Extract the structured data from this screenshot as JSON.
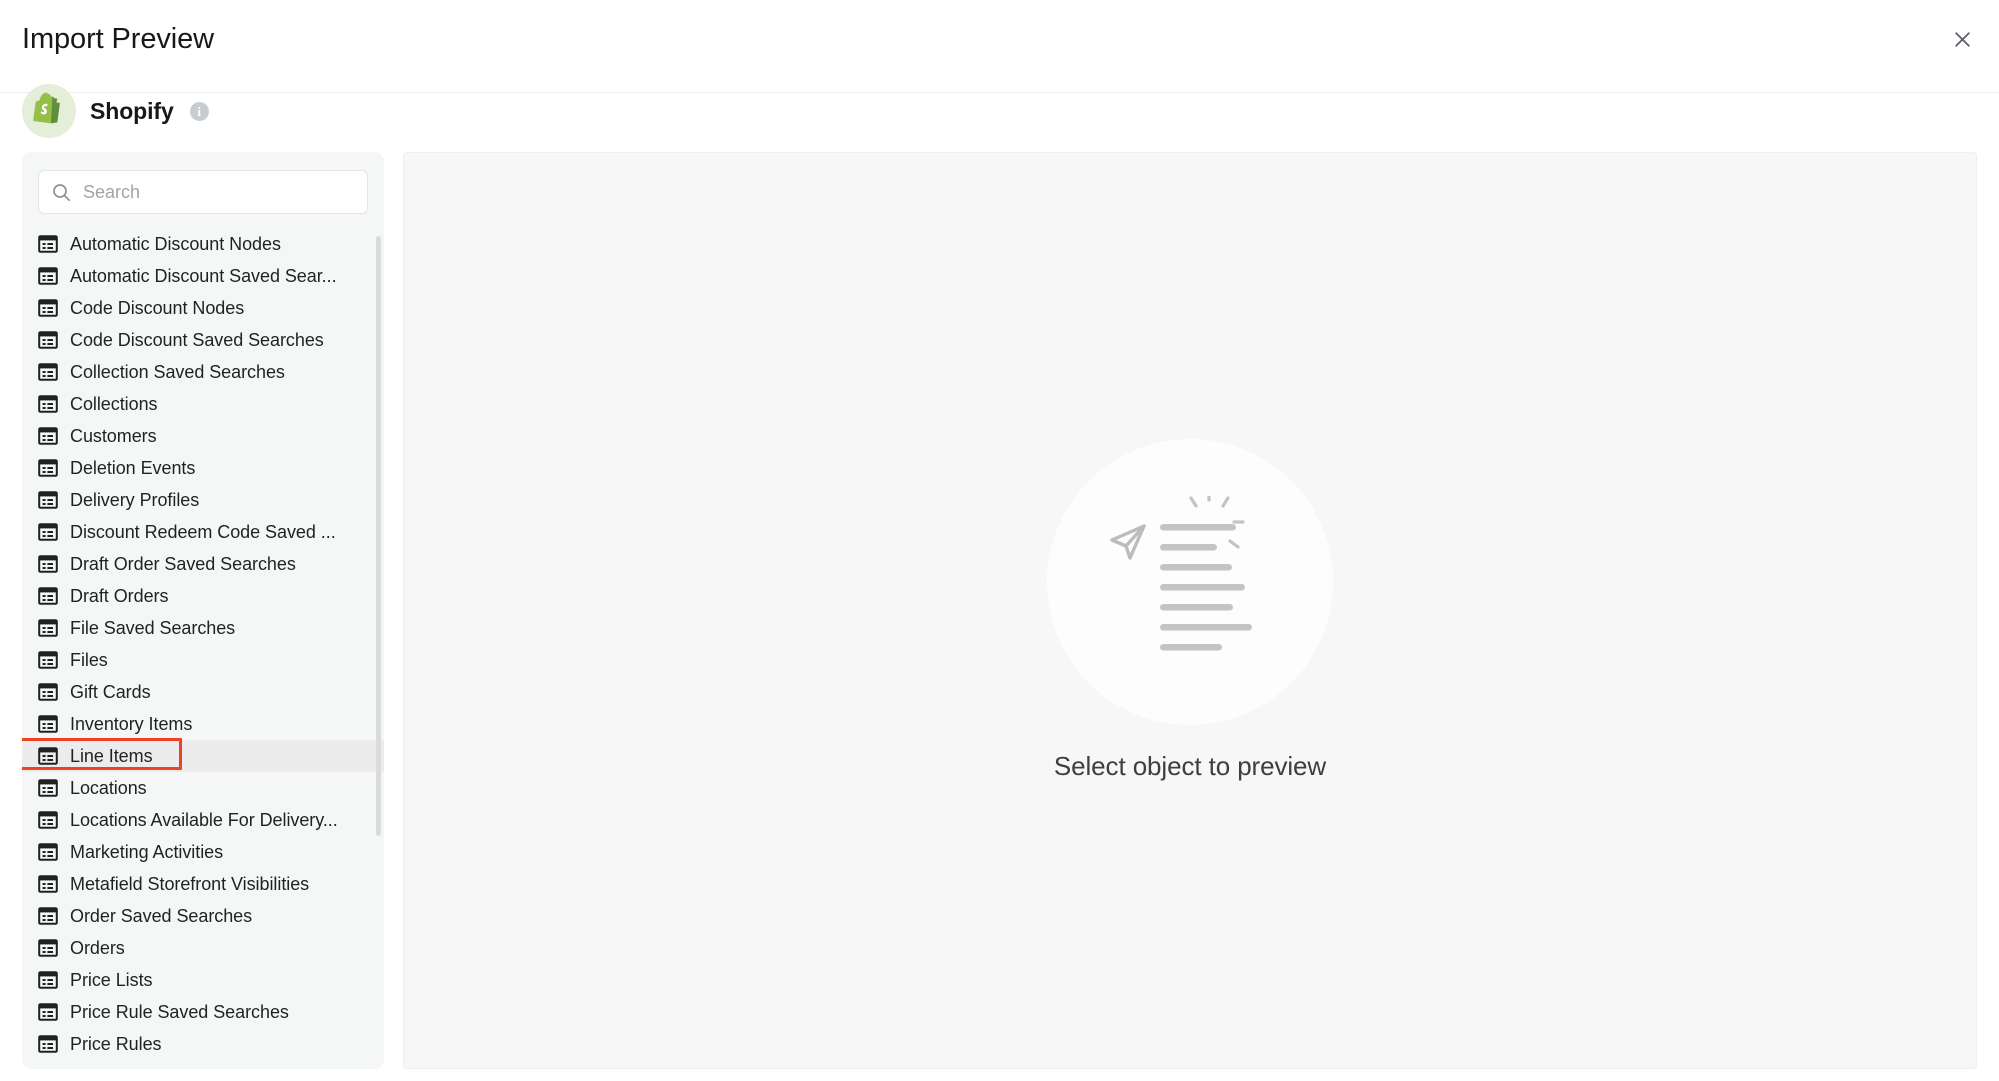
{
  "header": {
    "title": "Import Preview",
    "close_label": "×",
    "close_icon": "close-icon"
  },
  "source": {
    "name": "Shopify",
    "logo_icon": "shopify-logo-icon",
    "info_icon": "info-icon",
    "info_label": "i",
    "brand_color": "#95bf47",
    "logo_bg": "#e4eed8"
  },
  "search": {
    "placeholder": "Search",
    "value": "",
    "icon": "search-icon"
  },
  "object_list": {
    "row_icon": "table-icon",
    "highlighted": "Line Items",
    "annotation_color": "#ef4123",
    "items": [
      {
        "label": "Automatic Discount Nodes"
      },
      {
        "label": "Automatic Discount Saved Sear..."
      },
      {
        "label": "Code Discount Nodes"
      },
      {
        "label": "Code Discount Saved Searches"
      },
      {
        "label": "Collection Saved Searches"
      },
      {
        "label": "Collections"
      },
      {
        "label": "Customers"
      },
      {
        "label": "Deletion Events"
      },
      {
        "label": "Delivery Profiles"
      },
      {
        "label": "Discount Redeem Code Saved ..."
      },
      {
        "label": "Draft Order Saved Searches"
      },
      {
        "label": "Draft Orders"
      },
      {
        "label": "File Saved Searches"
      },
      {
        "label": "Files"
      },
      {
        "label": "Gift Cards"
      },
      {
        "label": "Inventory Items"
      },
      {
        "label": "Line Items"
      },
      {
        "label": "Locations"
      },
      {
        "label": "Locations Available For Delivery..."
      },
      {
        "label": "Marketing Activities"
      },
      {
        "label": "Metafield Storefront Visibilities"
      },
      {
        "label": "Order Saved Searches"
      },
      {
        "label": "Orders"
      },
      {
        "label": "Price Lists"
      },
      {
        "label": "Price Rule Saved Searches"
      },
      {
        "label": "Price Rules"
      }
    ]
  },
  "preview": {
    "empty_caption": "Select object to preview",
    "empty_icon": "cursor-list-sparkle-icon"
  }
}
